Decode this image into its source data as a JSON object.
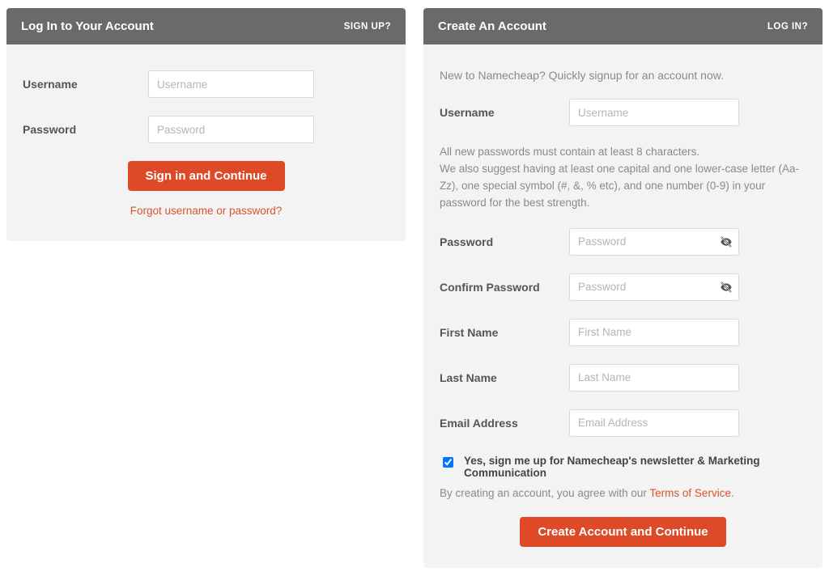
{
  "login": {
    "title": "Log In to Your Account",
    "altLink": "SIGN UP?",
    "usernameLabel": "Username",
    "usernamePlaceholder": "Username",
    "passwordLabel": "Password",
    "passwordPlaceholder": "Password",
    "submit": "Sign in and Continue",
    "forgot": "Forgot username or password?"
  },
  "signup": {
    "title": "Create An Account",
    "altLink": "LOG IN?",
    "intro": "New to Namecheap? Quickly signup for an account now.",
    "usernameLabel": "Username",
    "usernamePlaceholder": "Username",
    "passwordHint": "All new passwords must contain at least 8 characters.\nWe also suggest having at least one capital and one lower-case letter (Aa-Zz), one special symbol (#, &, % etc), and one number (0-9) in your password for the best strength.",
    "passwordLabel": "Password",
    "passwordPlaceholder": "Password",
    "confirmLabel": "Confirm Password",
    "confirmPlaceholder": "Password",
    "firstNameLabel": "First Name",
    "firstNamePlaceholder": "First Name",
    "lastNameLabel": "Last Name",
    "lastNamePlaceholder": "Last Name",
    "emailLabel": "Email Address",
    "emailPlaceholder": "Email Address",
    "newsletter": "Yes, sign me up for Namecheap's newsletter & Marketing Communication",
    "tosPrefix": "By creating an account, you agree with our ",
    "tosLink": "Terms of Service",
    "tosSuffix": ".",
    "submit": "Create Account and Continue"
  }
}
